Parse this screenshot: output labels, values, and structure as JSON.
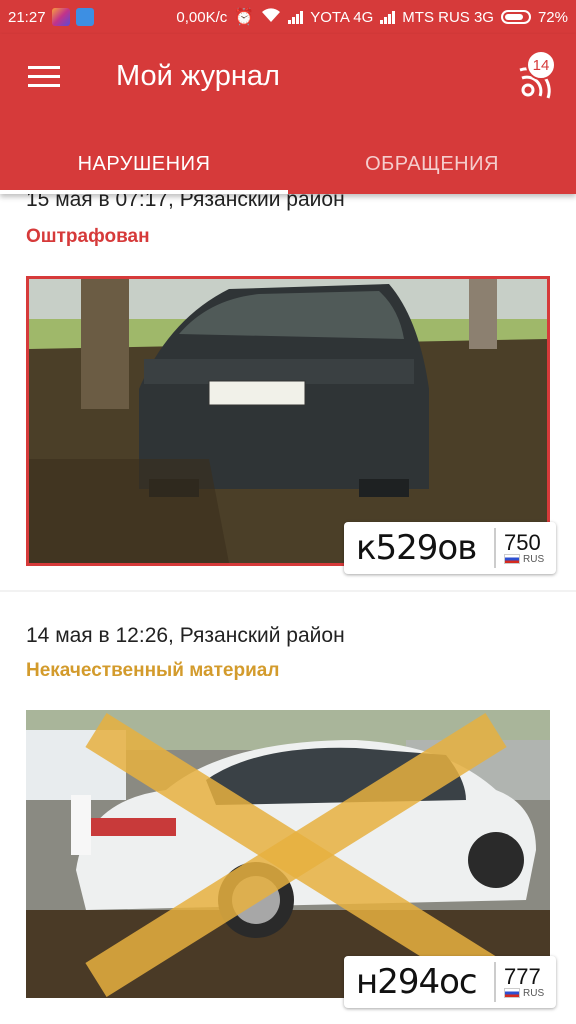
{
  "status_bar": {
    "time": "21:27",
    "speed": "0,00K/c",
    "carrier1": "YOTA 4G",
    "carrier2": "MTS RUS 3G",
    "battery": "72%"
  },
  "app_bar": {
    "title": "Мой журнал",
    "notification_count": "14"
  },
  "tabs": [
    {
      "label": "НАРУШЕНИЯ",
      "active": true
    },
    {
      "label": "ОБРАЩЕНИЯ",
      "active": false
    }
  ],
  "violations": [
    {
      "date_location": "15 мая в 07:17, Рязанский район",
      "status": "Оштрафован",
      "status_color": "#d63a3a",
      "plate_number": "к529ов",
      "plate_region": "750",
      "plate_country": "RUS"
    },
    {
      "date_location": "14 мая в 12:26, Рязанский район",
      "status": "Некачественный материал",
      "status_color": "#d39b2c",
      "plate_number": "н294ос",
      "plate_region": "777",
      "plate_country": "RUS"
    }
  ]
}
